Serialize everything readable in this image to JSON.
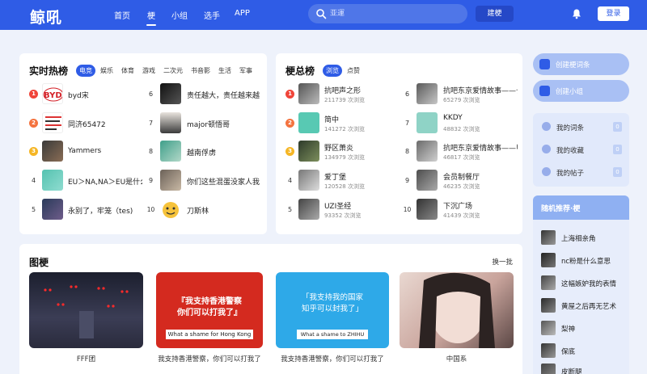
{
  "header": {
    "logo": "鲸吼",
    "nav": [
      "首页",
      "梗",
      "小组",
      "选手",
      "APP"
    ],
    "search_placeholder": "亚運",
    "build_label": "建梗",
    "login_label": "登录"
  },
  "hot": {
    "title": "实时热榜",
    "tabs": [
      "电竞",
      "娱乐",
      "体育",
      "游戏",
      "二次元",
      "书音影",
      "生活",
      "军事"
    ],
    "items": [
      {
        "rank": "1",
        "name": "byd宋"
      },
      {
        "rank": "2",
        "name": "同济65472"
      },
      {
        "rank": "3",
        "name": "Yammers"
      },
      {
        "rank": "4",
        "name": "EU＞NA,NA＞EU是什么"
      },
      {
        "rank": "5",
        "name": "永别了，牢笼（tes)"
      },
      {
        "rank": "6",
        "name": "责任越大，责任越来越"
      },
      {
        "rank": "7",
        "name": "major顿悟哥"
      },
      {
        "rank": "8",
        "name": "越南俘虏"
      },
      {
        "rank": "9",
        "name": "你们这些混蛋没家人我和"
      },
      {
        "rank": "10",
        "name": "刀斯林"
      }
    ]
  },
  "memes": {
    "title": "梗总榜",
    "tabs": [
      "浏览",
      "点赞"
    ],
    "items": [
      {
        "rank": "1",
        "name": "抗吧声之形",
        "views": "211739 次浏览"
      },
      {
        "rank": "2",
        "name": "简中",
        "views": "141272 次浏览"
      },
      {
        "rank": "3",
        "name": "野区萧炎",
        "views": "134979 次浏览"
      },
      {
        "rank": "4",
        "name": "爱丁堡",
        "views": "120528 次浏览"
      },
      {
        "rank": "5",
        "name": "UZI圣经",
        "views": "93352 次浏览"
      },
      {
        "rank": "6",
        "name": "抗吧东京爱情故事——长篇",
        "views": "65279 次浏览"
      },
      {
        "rank": "7",
        "name": "KKDY",
        "views": "48832 次浏览"
      },
      {
        "rank": "8",
        "name": "抗吧东京爱情故事——甲篇",
        "views": "46817 次浏览"
      },
      {
        "rank": "9",
        "name": "会员制餐厅",
        "views": "46235 次浏览"
      },
      {
        "rank": "10",
        "name": "下沉广场",
        "views": "41439 次浏览"
      }
    ]
  },
  "pics": {
    "title": "图梗",
    "refresh_label": "换一批",
    "items": [
      {
        "caption": "FFF团"
      },
      {
        "caption": "我支持香港警察，你们可以打我了",
        "line1": "『我支持香港警察",
        "line2": "你们可以打我了』",
        "sub": "What a shame for Hong Kong"
      },
      {
        "caption": "我支持香港警察，你们可以打我了",
        "line1": "「我支持我的国家",
        "line2": "知乎可以封我了」",
        "sub": "What a shame to ZHIHU"
      },
      {
        "caption": "中国系"
      }
    ]
  },
  "sidebar": {
    "create_meme": "创建梗词条",
    "create_group": "创建小组",
    "links": [
      {
        "label": "我的词条",
        "count": "0"
      },
      {
        "label": "我的收藏",
        "count": "0"
      },
      {
        "label": "我的帖子",
        "count": "0"
      }
    ],
    "random_title": "随机推荐·梗",
    "random": [
      "上海相亲角",
      "nc粉是什么意思",
      "这幅嫉妒我的表情",
      "黄屋之后再无艺术",
      "梨神",
      "保底",
      "皮断腿"
    ]
  },
  "colors": {
    "brand": "#2f5ce6",
    "rank1": "#f0453a",
    "rank2": "#f4733f",
    "rank3": "#f5b625"
  }
}
